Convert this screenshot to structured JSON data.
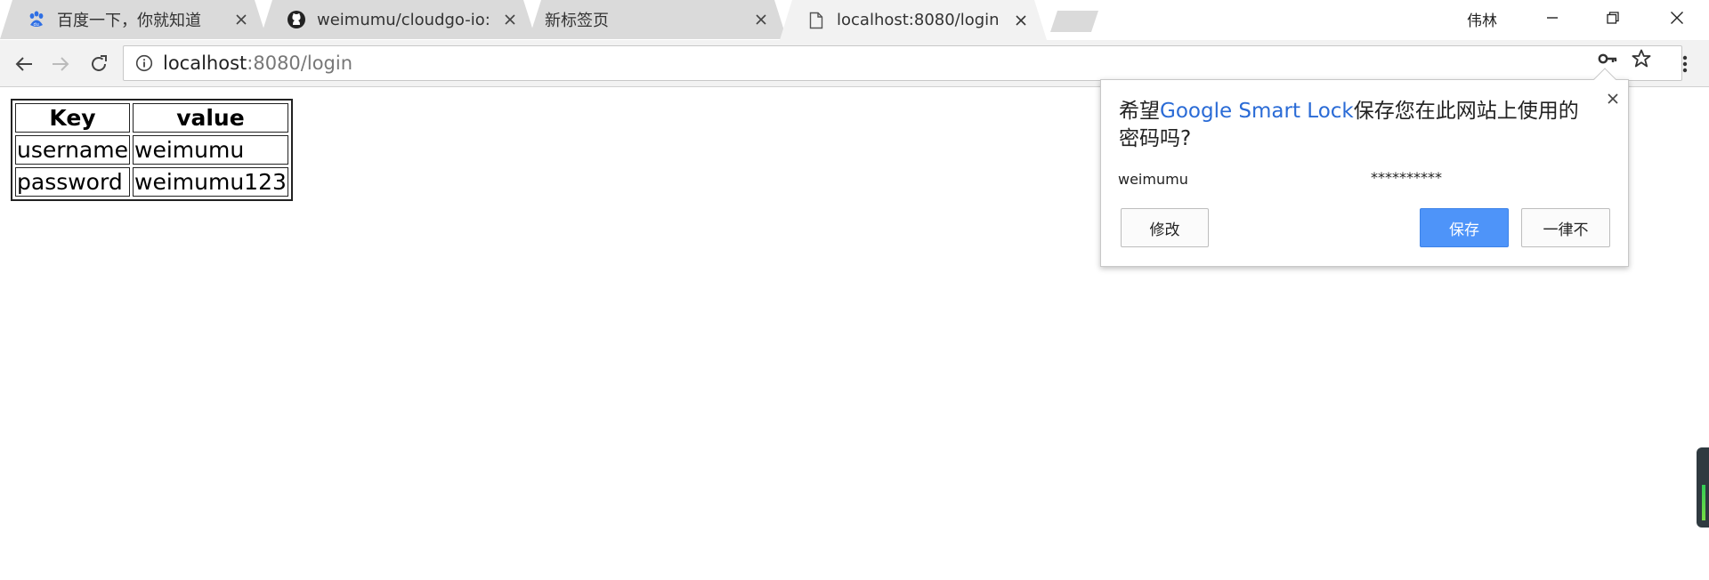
{
  "tabs": [
    {
      "title": "百度一下，你就知道",
      "icon": "baidu-paw-icon"
    },
    {
      "title": "weimumu/cloudgo-io:",
      "icon": "github-icon"
    },
    {
      "title": "新标签页",
      "icon": ""
    },
    {
      "title": "localhost:8080/login",
      "icon": "page-icon",
      "active": true
    }
  ],
  "window": {
    "user": "伟林"
  },
  "address_bar": {
    "host": "localhost",
    "rest": ":8080/login"
  },
  "page": {
    "table": {
      "headers": [
        "Key",
        "value"
      ],
      "rows": [
        [
          "username",
          "weimumu"
        ],
        [
          "password",
          "weimumu123"
        ]
      ]
    }
  },
  "password_bubble": {
    "heading_prefix": "希望",
    "heading_link": "Google Smart Lock",
    "heading_suffix": "保存您在此网站上使用的密码吗?",
    "username": "weimumu",
    "password_mask": "**********",
    "edit_label": "修改",
    "save_label": "保存",
    "never_label": "一律不"
  },
  "colors": {
    "accent_blue": "#4e94f9",
    "link_blue": "#2a6bd6",
    "tab_bg": "#dadada",
    "toolbar_bg": "#f2f2f2"
  }
}
